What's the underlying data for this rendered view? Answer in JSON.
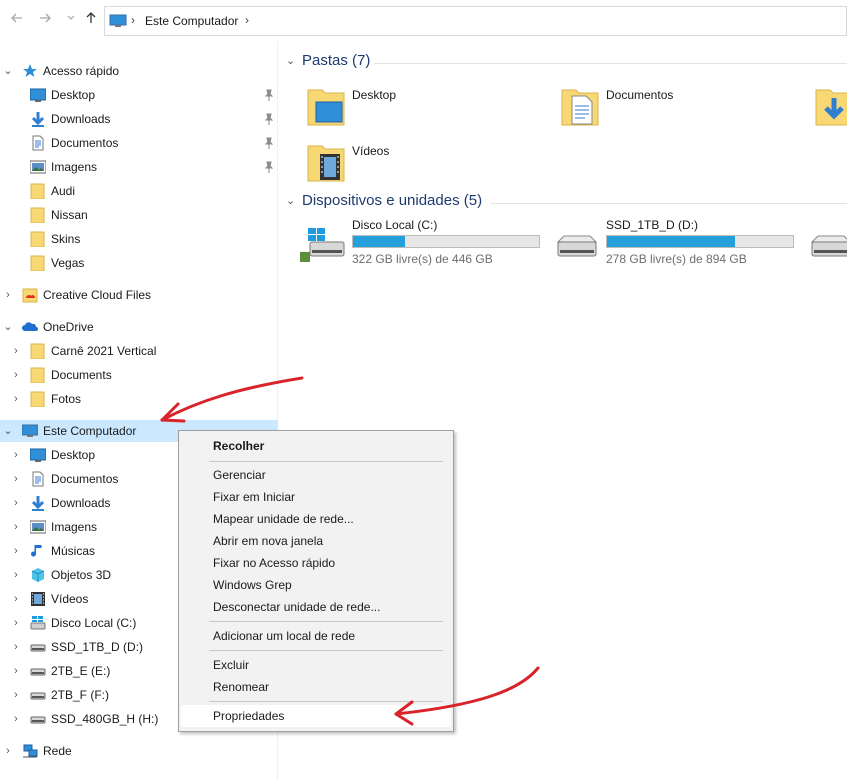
{
  "nav": {
    "back_icon": "arrow-left-icon",
    "forward_icon": "arrow-right-icon",
    "recent_icon": "chevron-down-icon",
    "up_icon": "arrow-up-icon",
    "address_path": "Este Computador",
    "address_sep": "›"
  },
  "sidebar": {
    "quick_access": {
      "label": "Acesso rápido",
      "items": [
        {
          "label": "Desktop",
          "icon": "desktop-icon",
          "pinned": true
        },
        {
          "label": "Downloads",
          "icon": "downloads-icon",
          "pinned": true
        },
        {
          "label": "Documentos",
          "icon": "documents-icon",
          "pinned": true
        },
        {
          "label": "Imagens",
          "icon": "images-icon",
          "pinned": true
        },
        {
          "label": "Audi",
          "icon": "folder-icon",
          "pinned": false
        },
        {
          "label": "Nissan",
          "icon": "folder-icon",
          "pinned": false
        },
        {
          "label": "Skins",
          "icon": "folder-icon",
          "pinned": false
        },
        {
          "label": "Vegas",
          "icon": "folder-icon",
          "pinned": false
        }
      ]
    },
    "creative_cloud": {
      "label": "Creative Cloud Files"
    },
    "onedrive": {
      "label": "OneDrive",
      "items": [
        {
          "label": "Carnê 2021 Vertical"
        },
        {
          "label": "Documents"
        },
        {
          "label": "Fotos"
        }
      ]
    },
    "this_pc": {
      "label": "Este Computador",
      "items": [
        {
          "label": "Desktop",
          "icon": "desktop-icon"
        },
        {
          "label": "Documentos",
          "icon": "documents-icon"
        },
        {
          "label": "Downloads",
          "icon": "downloads-icon"
        },
        {
          "label": "Imagens",
          "icon": "images-icon"
        },
        {
          "label": "Músicas",
          "icon": "music-icon"
        },
        {
          "label": "Objetos 3D",
          "icon": "3d-objects-icon"
        },
        {
          "label": "Vídeos",
          "icon": "videos-icon"
        },
        {
          "label": "Disco Local (C:)",
          "icon": "drive-icon"
        },
        {
          "label": "SSD_1TB_D (D:)",
          "icon": "drive-icon"
        },
        {
          "label": "2TB_E (E:)",
          "icon": "drive-icon"
        },
        {
          "label": "2TB_F (F:)",
          "icon": "drive-icon"
        },
        {
          "label": "SSD_480GB_H (H:)",
          "icon": "drive-icon"
        }
      ]
    },
    "network": {
      "label": "Rede"
    }
  },
  "main": {
    "folders_title": "Pastas (7)",
    "folders": [
      {
        "label": "Desktop"
      },
      {
        "label": "Documentos"
      },
      {
        "label": ""
      },
      {
        "label": "Vídeos"
      }
    ],
    "devices_title": "Dispositivos e unidades (5)",
    "drives": [
      {
        "label": "Disco Local (C:)",
        "free": "322 GB livre(s) de 446 GB",
        "used_fraction": 0.28
      },
      {
        "label": "SSD_1TB_D (D:)",
        "free": "278 GB livre(s) de 894 GB",
        "used_fraction": 0.69
      }
    ]
  },
  "context_menu": {
    "items": [
      {
        "label": "Recolher",
        "bold": true
      },
      {
        "label": "Gerenciar"
      },
      {
        "label": "Fixar em Iniciar"
      },
      {
        "label": "Mapear unidade de rede..."
      },
      {
        "label": "Abrir em nova janela"
      },
      {
        "label": "Fixar no Acesso rápido"
      },
      {
        "label": "Windows Grep"
      },
      {
        "label": "Desconectar unidade de rede..."
      },
      {
        "label": "Adicionar um local de rede"
      },
      {
        "label": "Excluir"
      },
      {
        "label": "Renomear"
      },
      {
        "label": "Propriedades",
        "highlighted": true
      }
    ]
  },
  "colors": {
    "selection": "#cce8ff",
    "accent_blue": "#26a0da",
    "section_title": "#1e3a6e",
    "annotation_red": "#d9232a",
    "folder_yellow": "#f8d775"
  }
}
